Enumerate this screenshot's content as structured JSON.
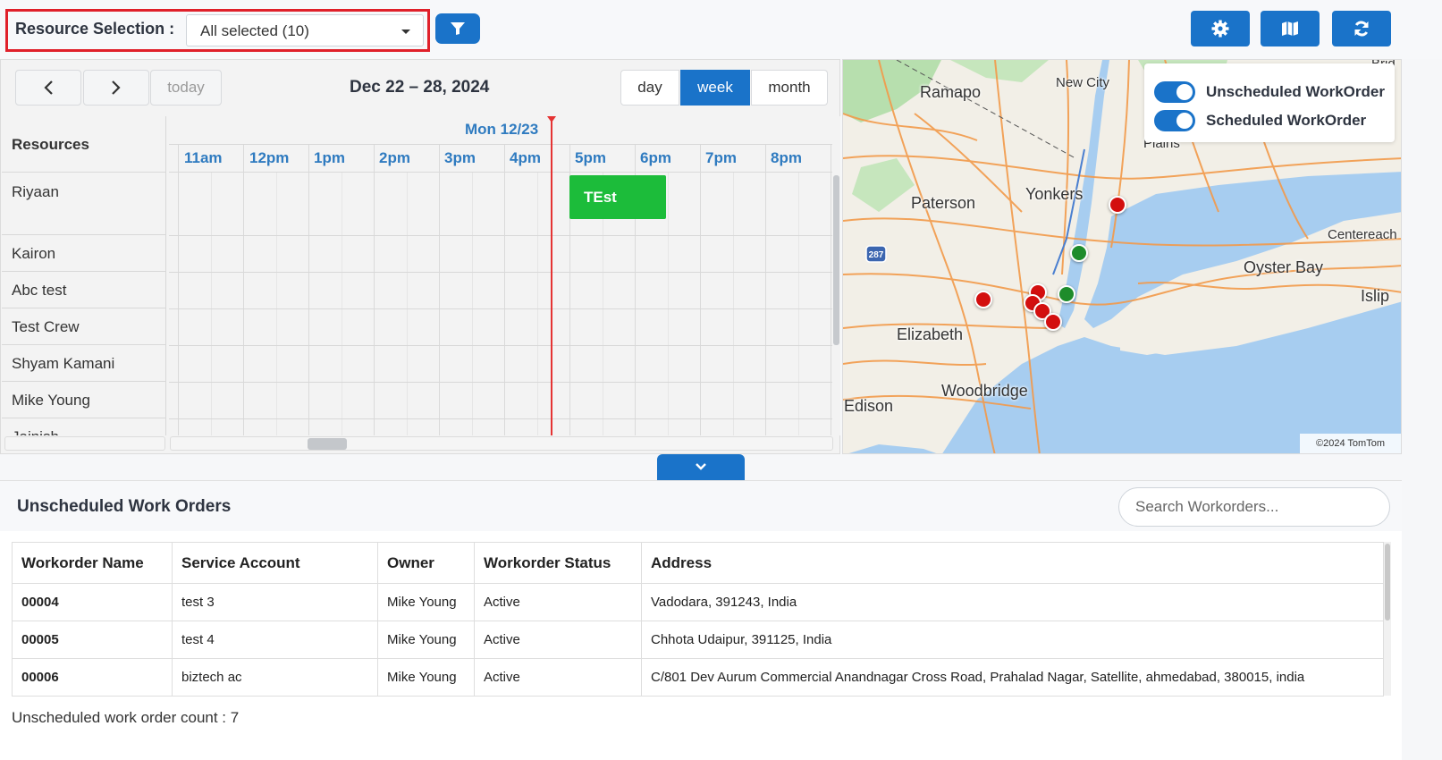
{
  "header": {
    "resource_label": "Resource Selection :",
    "resource_value": "All selected (10)"
  },
  "calendar": {
    "today_label": "today",
    "title": "Dec 22 – 28, 2024",
    "views": [
      "day",
      "week",
      "month"
    ],
    "active_view": "week",
    "resources_header": "Resources",
    "resources": [
      "Riyaan",
      "Kairon",
      "Abc test",
      "Test Crew",
      "Shyam Kamani",
      "Mike Young",
      "Jainish"
    ],
    "date_header": "Mon 12/23",
    "hours": [
      "11am",
      "12pm",
      "1pm",
      "2pm",
      "3pm",
      "4pm",
      "5pm",
      "6pm",
      "7pm",
      "8pm"
    ],
    "event": {
      "title": "TEst",
      "resource": "Riyaan",
      "color": "#1cbc3a"
    }
  },
  "map": {
    "places": [
      "Ramapo",
      "New City",
      "Paterson",
      "Yonkers",
      "Plains",
      "Centereach",
      "Oyster Bay",
      "Islip",
      "Elizabeth",
      "Woodbridge",
      "Edison",
      "Brid"
    ],
    "shield": "287",
    "legend": {
      "unscheduled": "Unscheduled WorkOrder",
      "scheduled": "Scheduled WorkOrder"
    },
    "copyright": "©2024 TomTom",
    "colors": {
      "unscheduled_pin": "#d30f0f",
      "scheduled_pin": "#1e8c2b"
    }
  },
  "unscheduled": {
    "title": "Unscheduled Work Orders",
    "search_placeholder": "Search Workorders...",
    "columns": [
      "Workorder Name",
      "Service Account",
      "Owner",
      "Workorder Status",
      "Address"
    ],
    "rows": [
      [
        "00004",
        "test 3",
        "Mike Young",
        "Active",
        "Vadodara, 391243, India"
      ],
      [
        "00005",
        "test 4",
        "Mike Young",
        "Active",
        "Chhota Udaipur, 391125, India"
      ],
      [
        "00006",
        "biztech ac",
        "Mike Young",
        "Active",
        "C/801 Dev Aurum Commercial Anandnagar Cross Road, Prahalad Nagar, Satellite, ahmedabad, 380015, india"
      ]
    ],
    "count_text": "Unscheduled work order count : 7"
  },
  "theme": {
    "accent": "#1a73c9",
    "highlight_border": "#e0202a",
    "now_line": "#e53333"
  }
}
